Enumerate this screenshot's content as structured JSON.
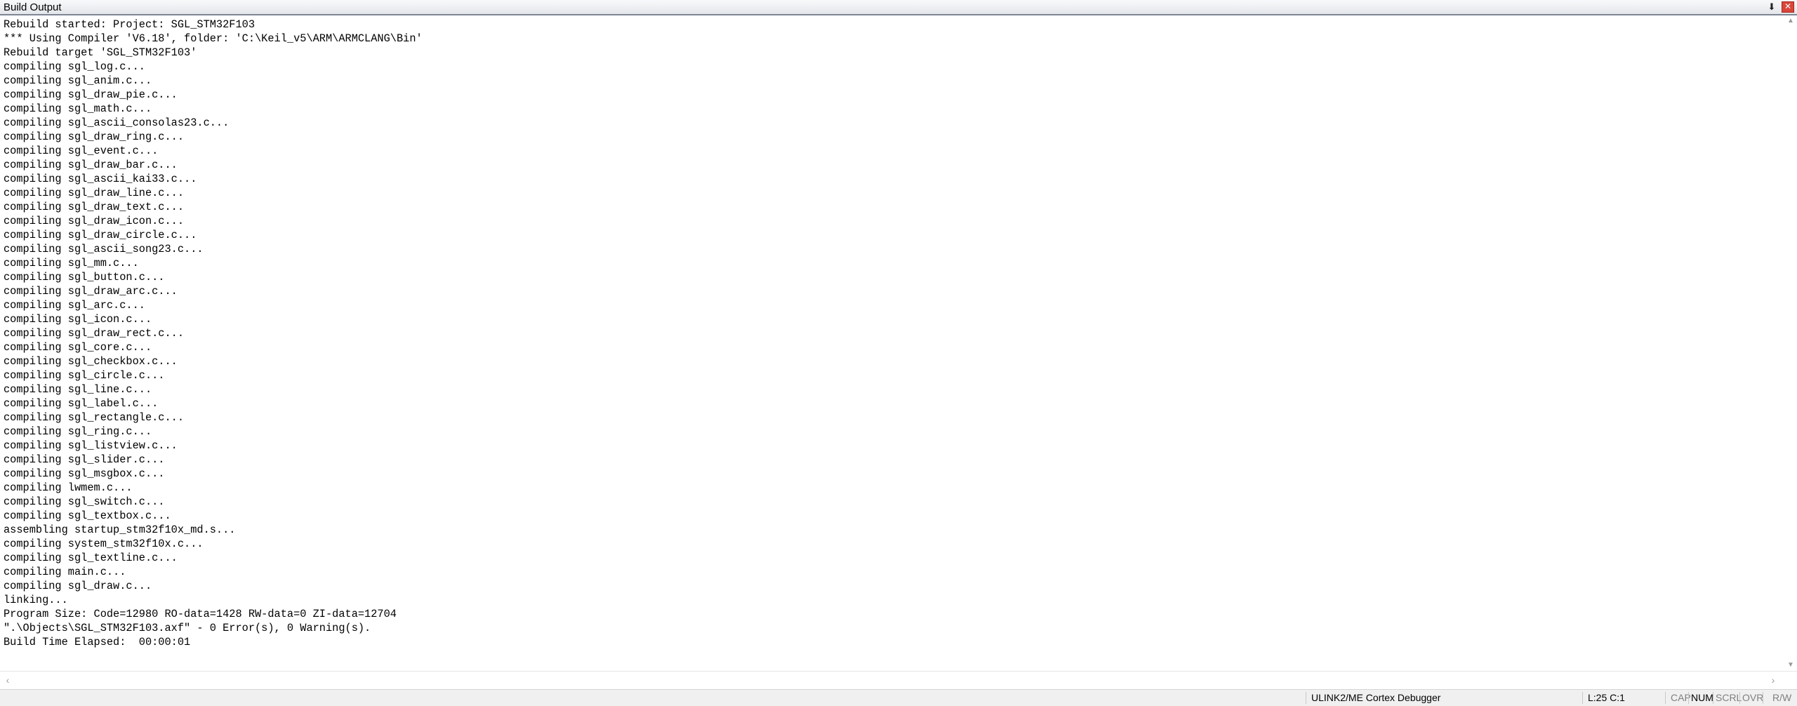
{
  "window": {
    "title": "Build Output",
    "pin_glyph": "⬇",
    "close_glyph": "✕"
  },
  "output_lines": [
    "Rebuild started: Project: SGL_STM32F103",
    "*** Using Compiler 'V6.18', folder: 'C:\\Keil_v5\\ARM\\ARMCLANG\\Bin'",
    "Rebuild target 'SGL_STM32F103'",
    "compiling sgl_log.c...",
    "compiling sgl_anim.c...",
    "compiling sgl_draw_pie.c...",
    "compiling sgl_math.c...",
    "compiling sgl_ascii_consolas23.c...",
    "compiling sgl_draw_ring.c...",
    "compiling sgl_event.c...",
    "compiling sgl_draw_bar.c...",
    "compiling sgl_ascii_kai33.c...",
    "compiling sgl_draw_line.c...",
    "compiling sgl_draw_text.c...",
    "compiling sgl_draw_icon.c...",
    "compiling sgl_draw_circle.c...",
    "compiling sgl_ascii_song23.c...",
    "compiling sgl_mm.c...",
    "compiling sgl_button.c...",
    "compiling sgl_draw_arc.c...",
    "compiling sgl_arc.c...",
    "compiling sgl_icon.c...",
    "compiling sgl_draw_rect.c...",
    "compiling sgl_core.c...",
    "compiling sgl_checkbox.c...",
    "compiling sgl_circle.c...",
    "compiling sgl_line.c...",
    "compiling sgl_label.c...",
    "compiling sgl_rectangle.c...",
    "compiling sgl_ring.c...",
    "compiling sgl_listview.c...",
    "compiling sgl_slider.c...",
    "compiling sgl_msgbox.c...",
    "compiling lwmem.c...",
    "compiling sgl_switch.c...",
    "compiling sgl_textbox.c...",
    "assembling startup_stm32f10x_md.s...",
    "compiling system_stm32f10x.c...",
    "compiling sgl_textline.c...",
    "compiling main.c...",
    "compiling sgl_draw.c...",
    "linking...",
    "Program Size: Code=12980 RO-data=1428 RW-data=0 ZI-data=12704",
    "\".\\Objects\\SGL_STM32F103.axf\" - 0 Error(s), 0 Warning(s).",
    "Build Time Elapsed:  00:00:01"
  ],
  "scrollbars": {
    "up_glyph": "▲",
    "down_glyph": "▼",
    "left_glyph": "‹",
    "right_glyph": "›"
  },
  "statusbar": {
    "debugger": "ULINK2/ME Cortex Debugger",
    "position": "L:25 C:1",
    "cap": "CAP",
    "num": "NUM",
    "scrl": "SCRL",
    "ovr": "OVR",
    "rw": "R/W"
  }
}
